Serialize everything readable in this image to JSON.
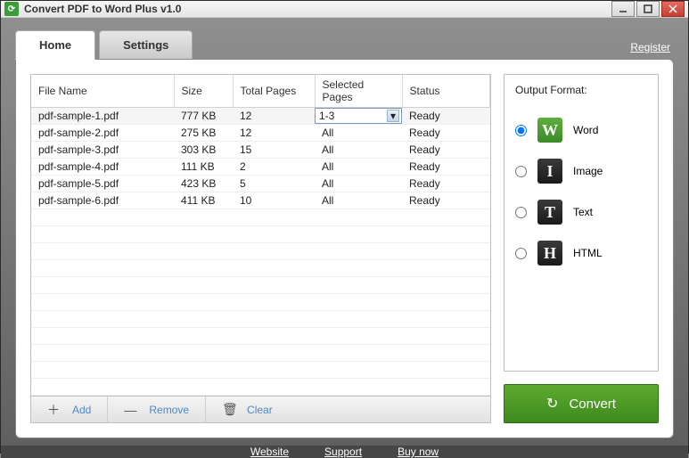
{
  "window": {
    "title": "Convert PDF to Word Plus v1.0"
  },
  "register": "Register",
  "tabs": {
    "home": "Home",
    "settings": "Settings"
  },
  "table": {
    "headers": {
      "file_name": "File Name",
      "size": "Size",
      "total_pages": "Total Pages",
      "selected_pages": "Selected Pages",
      "status": "Status"
    },
    "rows": [
      {
        "file": "pdf-sample-1.pdf",
        "size": "777 KB",
        "total": "12",
        "sel": "1-3",
        "status": "Ready"
      },
      {
        "file": "pdf-sample-2.pdf",
        "size": "275 KB",
        "total": "12",
        "sel": "All",
        "status": "Ready"
      },
      {
        "file": "pdf-sample-3.pdf",
        "size": "303 KB",
        "total": "15",
        "sel": "All",
        "status": "Ready"
      },
      {
        "file": "pdf-sample-4.pdf",
        "size": "111 KB",
        "total": "2",
        "sel": "All",
        "status": "Ready"
      },
      {
        "file": "pdf-sample-5.pdf",
        "size": "423 KB",
        "total": "5",
        "sel": "All",
        "status": "Ready"
      },
      {
        "file": "pdf-sample-6.pdf",
        "size": "411 KB",
        "total": "10",
        "sel": "All",
        "status": "Ready"
      }
    ]
  },
  "actions": {
    "add": "Add",
    "remove": "Remove",
    "clear": "Clear"
  },
  "output": {
    "title": "Output Format:",
    "word": "Word",
    "image": "Image",
    "text": "Text",
    "html": "HTML",
    "selected": "word"
  },
  "convert": "Convert",
  "footer": {
    "website": "Website",
    "support": "Support",
    "buy": "Buy now"
  }
}
